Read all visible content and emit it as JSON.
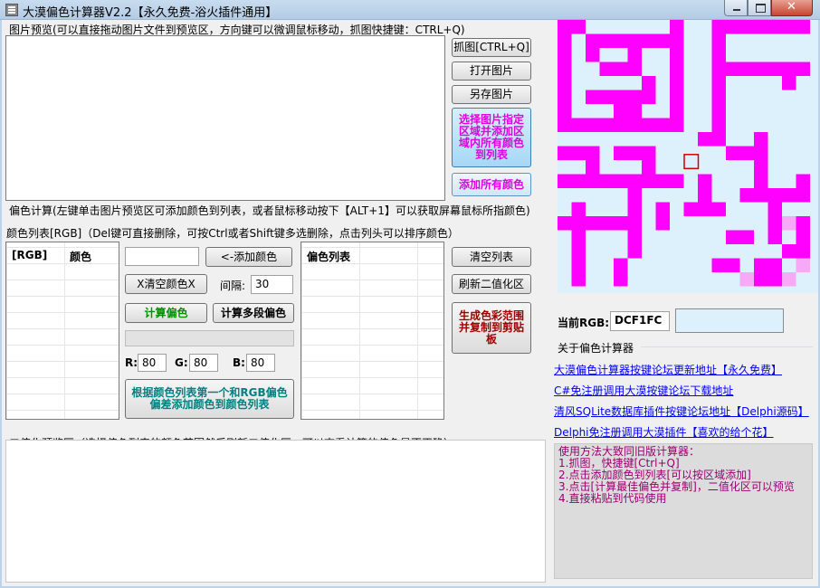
{
  "window": {
    "title": "大漠偏色计算器V2.2【永久免费-浴火插件通用】"
  },
  "preview": {
    "hint": "图片预览(可以直接拖动图片文件到预览区，方向键可以微调鼠标移动，抓图快捷键：CTRL+Q)"
  },
  "buttons": {
    "capture": "抓图[CTRL+Q]",
    "open": "打开图片",
    "save_as": "另存图片",
    "select_region": "选择图片指定区域并添加区域内所有颜色到列表",
    "add_all": "添加所有颜色",
    "add_color": "<-添加颜色",
    "clear_color": "X清空颜色X",
    "calc_offset": "计算偏色",
    "calc_multi": "计算多段偏色",
    "add_by_first": "根据颜色列表第一个和RGB偏色偏差添加颜色到颜色列表",
    "clear_list": "清空列表",
    "refresh_binary": "刷新二值化区",
    "generate_copy": "生成色彩范围并复制到剪贴板"
  },
  "offset_calc": {
    "title": "偏色计算(左键单击图片预览区可添加颜色到列表，或者鼠标移动按下【ALT+1】可以获取屏幕鼠标所指颜色)",
    "color_list_hint": "颜色列表[RGB]（Del键可直接删除，可按Ctrl或者Shift键多选删除，点击列头可以排序颜色）",
    "col_rgb": "[RGB]",
    "col_color": "颜色",
    "col_offset_list": "偏色列表",
    "color_input": "",
    "interval_label": "间隔:",
    "interval_value": "30",
    "r_label": "R:",
    "r_value": "80",
    "g_label": "G:",
    "g_value": "80",
    "b_label": "B:",
    "b_value": "80"
  },
  "binary": {
    "hint": "二值化预览区（选择偏色列表的颜色范围然后刷新二值化区，可以查看计算的偏色是否正确）"
  },
  "current_rgb": {
    "label": "当前RGB:",
    "value": "DCF1FC",
    "swatch_color": "#DCF1FC"
  },
  "about": {
    "title": "关于偏色计算器",
    "links": [
      "大漠偏色计算器按键论坛更新地址【永久免费】",
      "C#免注册调用大漠按键论坛下载地址",
      "清风SQLite数据库插件按键论坛地址【Delphi源码】",
      "Delphi免注册调用大漠插件【喜欢的给个花】"
    ],
    "usage_title": "使用方法大致同旧版计算器：",
    "usage_lines": [
      "1.抓图，快捷键[Ctrl+Q]",
      "2.点击添加颜色到列表[可以按区域添加]",
      "3.点击[计算最佳偏色并复制]，二值化区可以预览",
      "4.直接粘贴到代码使用"
    ]
  },
  "colors": {
    "magenta": "#FF00FF",
    "light_blue": "#DCF1FC",
    "link_blue": "#0000FF"
  }
}
